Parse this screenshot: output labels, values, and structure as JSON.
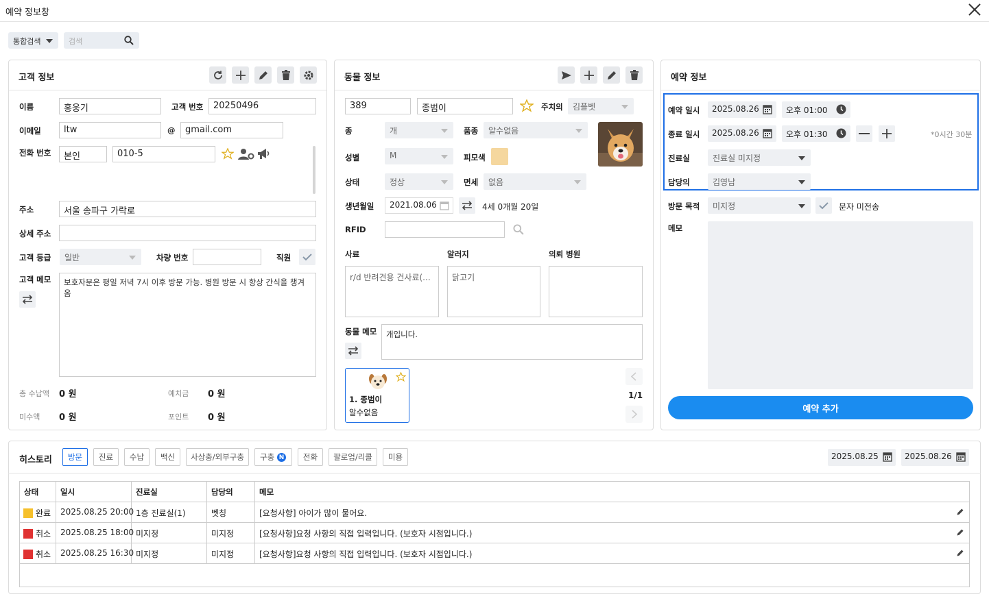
{
  "window": {
    "title": "예약 정보창"
  },
  "search": {
    "scope_label": "통합검색",
    "placeholder": "검색"
  },
  "customer": {
    "title": "고객 정보",
    "name_label": "이름",
    "name": "홍웅기",
    "number_label": "고객 번호",
    "number": "20250496",
    "email_label": "이메일",
    "email_user": "ltw",
    "at": "@",
    "email_domain": "gmail.com",
    "phone_label": "전화 번호",
    "phone_owner": "본인",
    "phone": "010-5",
    "address_label": "주소",
    "address": "서울 송파구 가락로",
    "detail_address_label": "상세 주소",
    "detail_address": "",
    "grade_label": "고객 등급",
    "grade": "일반",
    "car_label": "차량 번호",
    "car": "",
    "staff_label": "직원",
    "memo_label": "고객 메모",
    "memo": "보호자분은 평일 저녁 7시 이후 방문 가능. 병원 방문 시 항상 간식을 챙겨옴",
    "total_paid_label": "총 수납액",
    "total_paid": "0 원",
    "deposit_label": "예치금",
    "deposit": "0 원",
    "unpaid_label": "미수액",
    "unpaid": "0 원",
    "points_label": "포인트",
    "points": "0 원"
  },
  "animal": {
    "title": "동물 정보",
    "chart_no": "389",
    "name": "종범이",
    "main_doctor_label": "주치의",
    "main_doctor": "김플벳",
    "species_label": "종",
    "species": "개",
    "breed_label": "품종",
    "breed": "알수없음",
    "sex_label": "성별",
    "sex": "M",
    "coat_label": "피모색",
    "coat_color": "#f5d79e",
    "status_label": "상태",
    "status": "정상",
    "neuter_label": "면세",
    "neuter": "없음",
    "birth_label": "생년월일",
    "birth": "2021.08.06",
    "age": "4세 0개월 20일",
    "rfid_label": "RFID",
    "rfid": "",
    "reason_label": "사료",
    "reason": "r/d 반려견용 건사료(...",
    "allergy_label": "알러지",
    "allergy": "닭고기",
    "referral_label": "의뢰 병원",
    "referral": "",
    "memo_label": "동물 메모",
    "memo": "개입니다.",
    "card_name": "1. 종범이",
    "card_breed": "알수없음",
    "pager": "1/1"
  },
  "reservation": {
    "title": "예약 정보",
    "start_label": "예약 일시",
    "start_date": "2025.08.26",
    "start_time": "오후 01:00",
    "end_label": "종료 일시",
    "end_date": "2025.08.26",
    "end_time": "오후 01:30",
    "duration": "*0시간 30분",
    "room_label": "진료실",
    "room": "진료실 미지정",
    "doctor_label": "담당의",
    "doctor": "김영남",
    "purpose_label": "방문 목적",
    "purpose": "미지정",
    "sms": "문자 미전송",
    "memo_label": "메모",
    "memo": "",
    "add_button": "예약 추가"
  },
  "history": {
    "title": "히스토리",
    "tabs": [
      "방문",
      "진료",
      "수납",
      "백신",
      "사상충/외부구충",
      "구충",
      "전화",
      "팔로업/리콜",
      "미용"
    ],
    "badge": "N",
    "date_from": "2025.08.25",
    "date_to": "2025.08.26",
    "columns": [
      "상태",
      "일시",
      "진료실",
      "담당의",
      "메모"
    ],
    "rows": [
      {
        "status": "완료",
        "status_color": "#f6c02b",
        "datetime": "2025.08.25 20:00",
        "room": "1층 진료실(1)",
        "doctor": "벳칭",
        "memo": "[요청사항] 아이가 많이 물어요."
      },
      {
        "status": "취소",
        "status_color": "#e03232",
        "datetime": "2025.08.25 18:00",
        "room": "미지정",
        "doctor": "미지정",
        "memo": "[요청사항]요청 사항의 직접 입력입니다. (보호자 시점입니다.)"
      },
      {
        "status": "취소",
        "status_color": "#e03232",
        "datetime": "2025.08.25 16:30",
        "room": "미지정",
        "doctor": "미지정",
        "memo": "[요청사항]요청 사항의 직접 입력입니다. (보호자 시점입니다.)"
      }
    ]
  },
  "colors": {
    "accent": "#1e6fe6",
    "button_blue": "#1a8cf0"
  }
}
